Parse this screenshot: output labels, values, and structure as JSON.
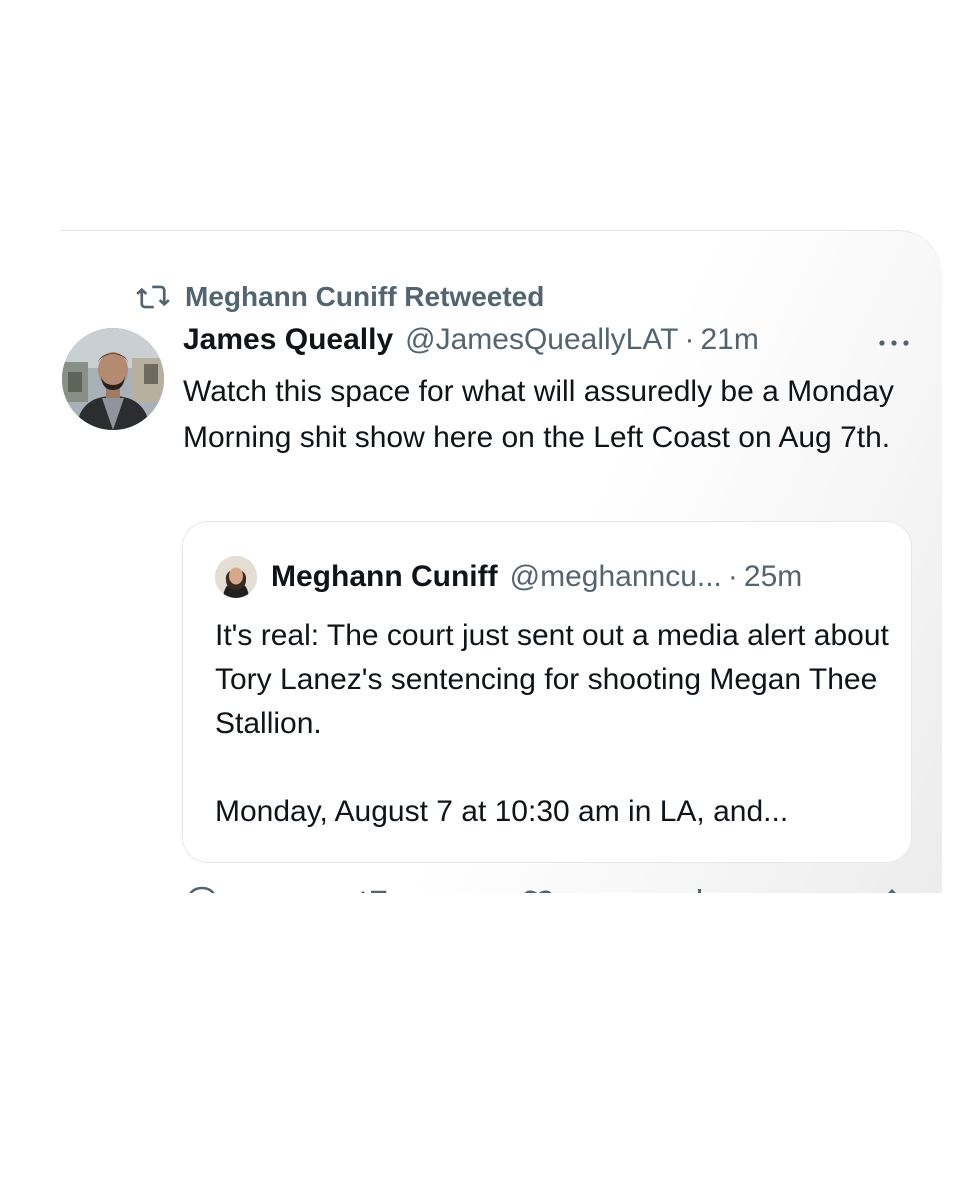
{
  "retweet_banner": {
    "icon": "retweet-icon",
    "text": "Meghann Cuniff Retweeted"
  },
  "tweet": {
    "author_name": "James Queally",
    "author_handle": "@JamesQueallyLAT",
    "separator": "·",
    "time": "21m",
    "more_icon": "more-horizontal-icon",
    "text": "Watch this space for what will assuredly be a Monday Morning shit show here on the Left Coast on Aug 7th."
  },
  "quote": {
    "author_name": "Meghann Cuniff",
    "author_handle": "@meghanncu...",
    "separator": "·",
    "time": "25m",
    "paragraphs": [
      "It's real: The court just sent out a media alert about Tory Lanez's sentencing for shooting Megan Thee Stallion.",
      "Monday, August 7 at 10:30 am in LA, and..."
    ]
  },
  "actions": [
    {
      "name": "reply",
      "icon": "reply-icon"
    },
    {
      "name": "retweet",
      "icon": "retweet-icon"
    },
    {
      "name": "like",
      "icon": "heart-icon"
    },
    {
      "name": "views",
      "icon": "views-icon"
    },
    {
      "name": "share",
      "icon": "share-icon"
    }
  ],
  "colors": {
    "text_primary": "#0f1419",
    "text_secondary": "#536471",
    "card_border": "#e1e8ed"
  }
}
